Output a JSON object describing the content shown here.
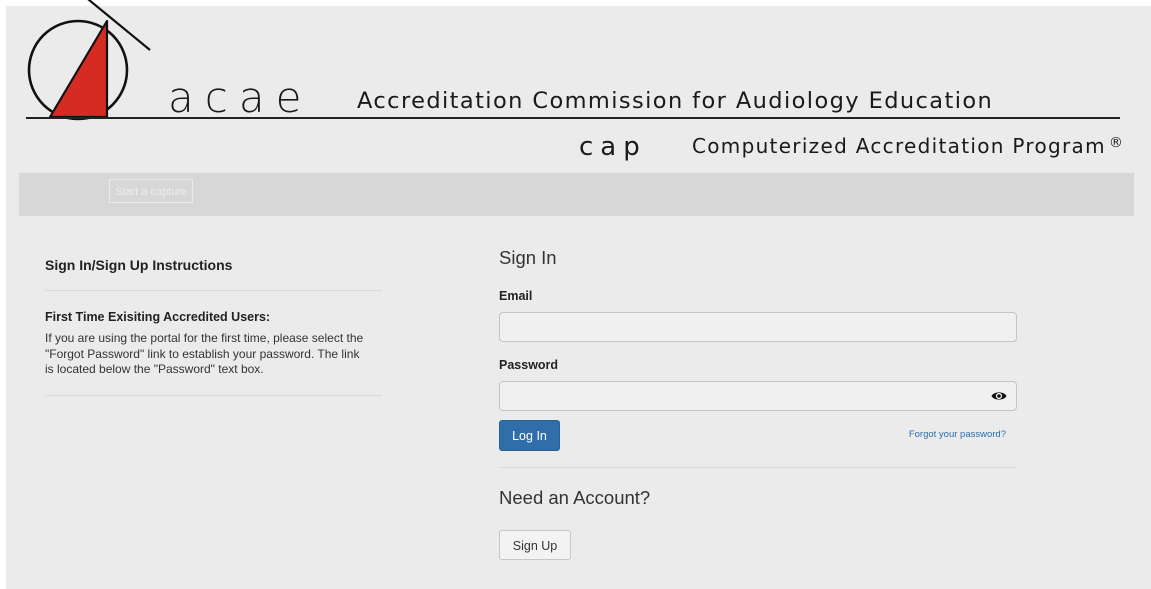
{
  "logo": {
    "acronym": "acae",
    "organization": "Accreditation Commission for Audiology Education",
    "program_acronym": "cap",
    "program_name": "Computerized Accreditation Program",
    "registered_mark": "®",
    "triangle_color": "#d62b22"
  },
  "toolbar": {
    "capture_label": "Start a capture"
  },
  "instructions": {
    "title": "Sign In/Sign Up Instructions",
    "subtitle": "First Time Exisiting Accredited Users:",
    "body": "If you are using the portal for the first time, please select the \"Forgot Password\" link to establish your password. The link is located below the \"Password\" text box."
  },
  "signin": {
    "title": "Sign In",
    "email_label": "Email",
    "email_value": "",
    "password_label": "Password",
    "password_value": "",
    "password_icon": "eye-icon",
    "login_label": "Log In",
    "forgot_label": "Forgot your password?",
    "need_account": "Need an Account?",
    "signup_label": "Sign Up"
  },
  "colors": {
    "primary": "#2f6ea8",
    "link": "#2a6db2",
    "background": "#ebebeb",
    "toolbar": "#d7d7d7"
  }
}
